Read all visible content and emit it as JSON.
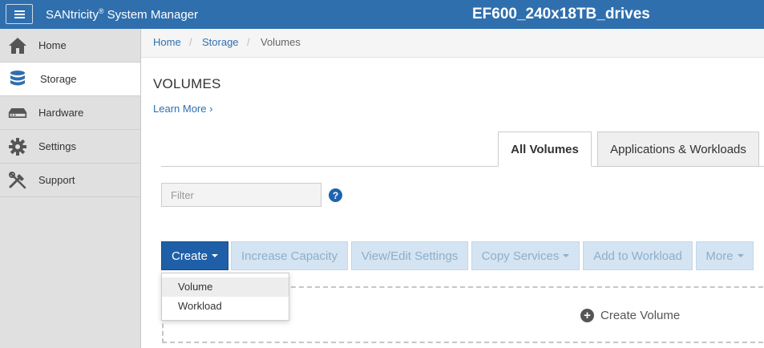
{
  "header": {
    "brand": "SANtricity",
    "reg_mark": "®",
    "app_suffix": " System Manager",
    "system_name": "EF600_240x18TB_drives"
  },
  "sidebar": {
    "items": [
      {
        "label": "Home",
        "icon": "home-icon"
      },
      {
        "label": "Storage",
        "icon": "storage-icon",
        "active": true
      },
      {
        "label": "Hardware",
        "icon": "hardware-icon"
      },
      {
        "label": "Settings",
        "icon": "gear-icon"
      },
      {
        "label": "Support",
        "icon": "tools-icon"
      }
    ]
  },
  "breadcrumb": {
    "home": "Home",
    "storage": "Storage",
    "current": "Volumes",
    "separator": "/"
  },
  "page": {
    "title": "VOLUMES",
    "learn_more": "Learn More",
    "learn_more_chevron": "›"
  },
  "tabs": {
    "all_volumes": "All Volumes",
    "apps_workloads": "Applications & Workloads"
  },
  "filter": {
    "placeholder": "Filter",
    "help": "?"
  },
  "toolbar": {
    "create": "Create",
    "increase_capacity": "Increase Capacity",
    "view_edit": "View/Edit Settings",
    "copy_services": "Copy Services",
    "add_to_workload": "Add to Workload",
    "more": "More"
  },
  "create_menu": {
    "volume": "Volume",
    "workload": "Workload"
  },
  "empty_state": {
    "create_volume": "Create Volume"
  },
  "colors": {
    "header_blue": "#2f6fae",
    "primary_button": "#1f5fa8",
    "link_blue": "#2f6fae"
  }
}
